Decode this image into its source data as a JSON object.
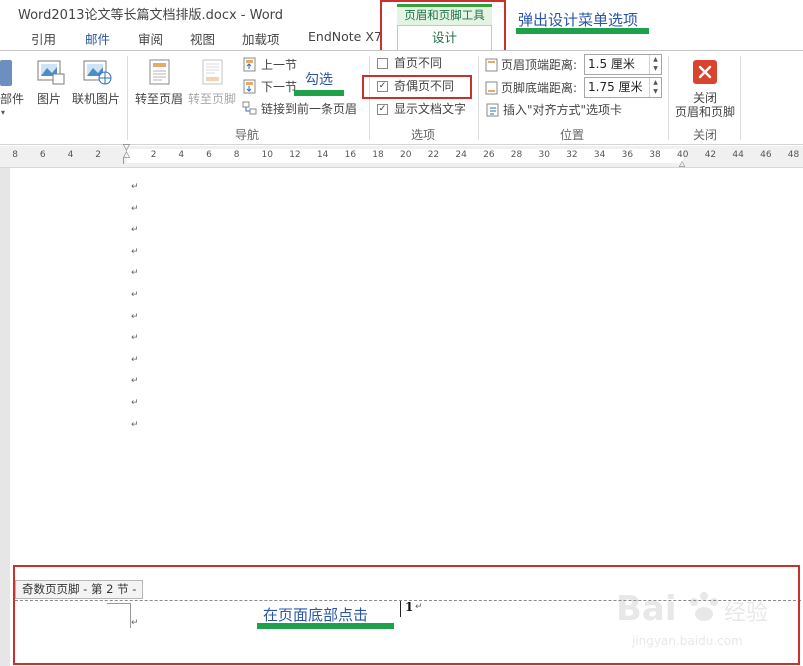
{
  "window": {
    "title": "Word2013论文等长篇文档排版.docx - Word"
  },
  "tabs": [
    {
      "label": "引用"
    },
    {
      "label": "邮件"
    },
    {
      "label": "审阅"
    },
    {
      "label": "视图"
    },
    {
      "label": "加载项"
    },
    {
      "label": "EndNote X7"
    }
  ],
  "context_tab": {
    "group_label": "页眉和页脚工具",
    "tab_label": "设计"
  },
  "ribbon": {
    "insert": {
      "parts_label": "部件",
      "picture_label": "图片",
      "online_picture_label": "联机图片"
    },
    "nav": {
      "goto_header": "转至页眉",
      "goto_footer": "转至页脚",
      "prev_section": "上一节",
      "next_section": "下一节",
      "link_previous": "链接到前一条页眉",
      "group_label": "导航"
    },
    "options": {
      "diff_first_page": {
        "label": "首页不同",
        "checked": false
      },
      "diff_odd_even": {
        "label": "奇偶页不同",
        "checked": true
      },
      "show_doc_text": {
        "label": "显示文档文字",
        "checked": true
      },
      "group_label": "选项",
      "check_mark": "✓"
    },
    "position": {
      "header_top_label": "页眉顶端距离:",
      "header_top_value": "1.5 厘米",
      "footer_bottom_label": "页脚底端距离:",
      "footer_bottom_value": "1.75 厘米",
      "insert_align_tab": "插入\"对齐方式\"选项卡",
      "group_label": "位置"
    },
    "close": {
      "label_line1": "关闭",
      "label_line2": "页眉和页脚",
      "group_label": "关闭"
    }
  },
  "ruler": {
    "left_ticks": [
      "8",
      "6",
      "4",
      "2"
    ],
    "right_ticks": [
      "2",
      "4",
      "6",
      "8",
      "10",
      "12",
      "14",
      "16",
      "18",
      "20",
      "22",
      "24",
      "26",
      "28",
      "30",
      "32",
      "34",
      "36",
      "38",
      "40",
      "42",
      "44",
      "46",
      "48"
    ]
  },
  "document": {
    "paragraph_mark": "↵",
    "footer_tag": "奇数页页脚 - 第 2 节 -",
    "page_number": "1"
  },
  "annotations": {
    "popup_design_menu": "弹出设计菜单选项",
    "check_it": "勾选",
    "click_bottom": "在页面底部点击"
  },
  "watermark": {
    "brand": "Baidu 经验",
    "url": "jingyan.baidu.com"
  },
  "colors": {
    "annotation_red": "#c8312d",
    "annotation_green": "#1fa14a",
    "annotation_text": "#2b56a6",
    "context_green": "#217346",
    "close_red": "#d9442f"
  }
}
